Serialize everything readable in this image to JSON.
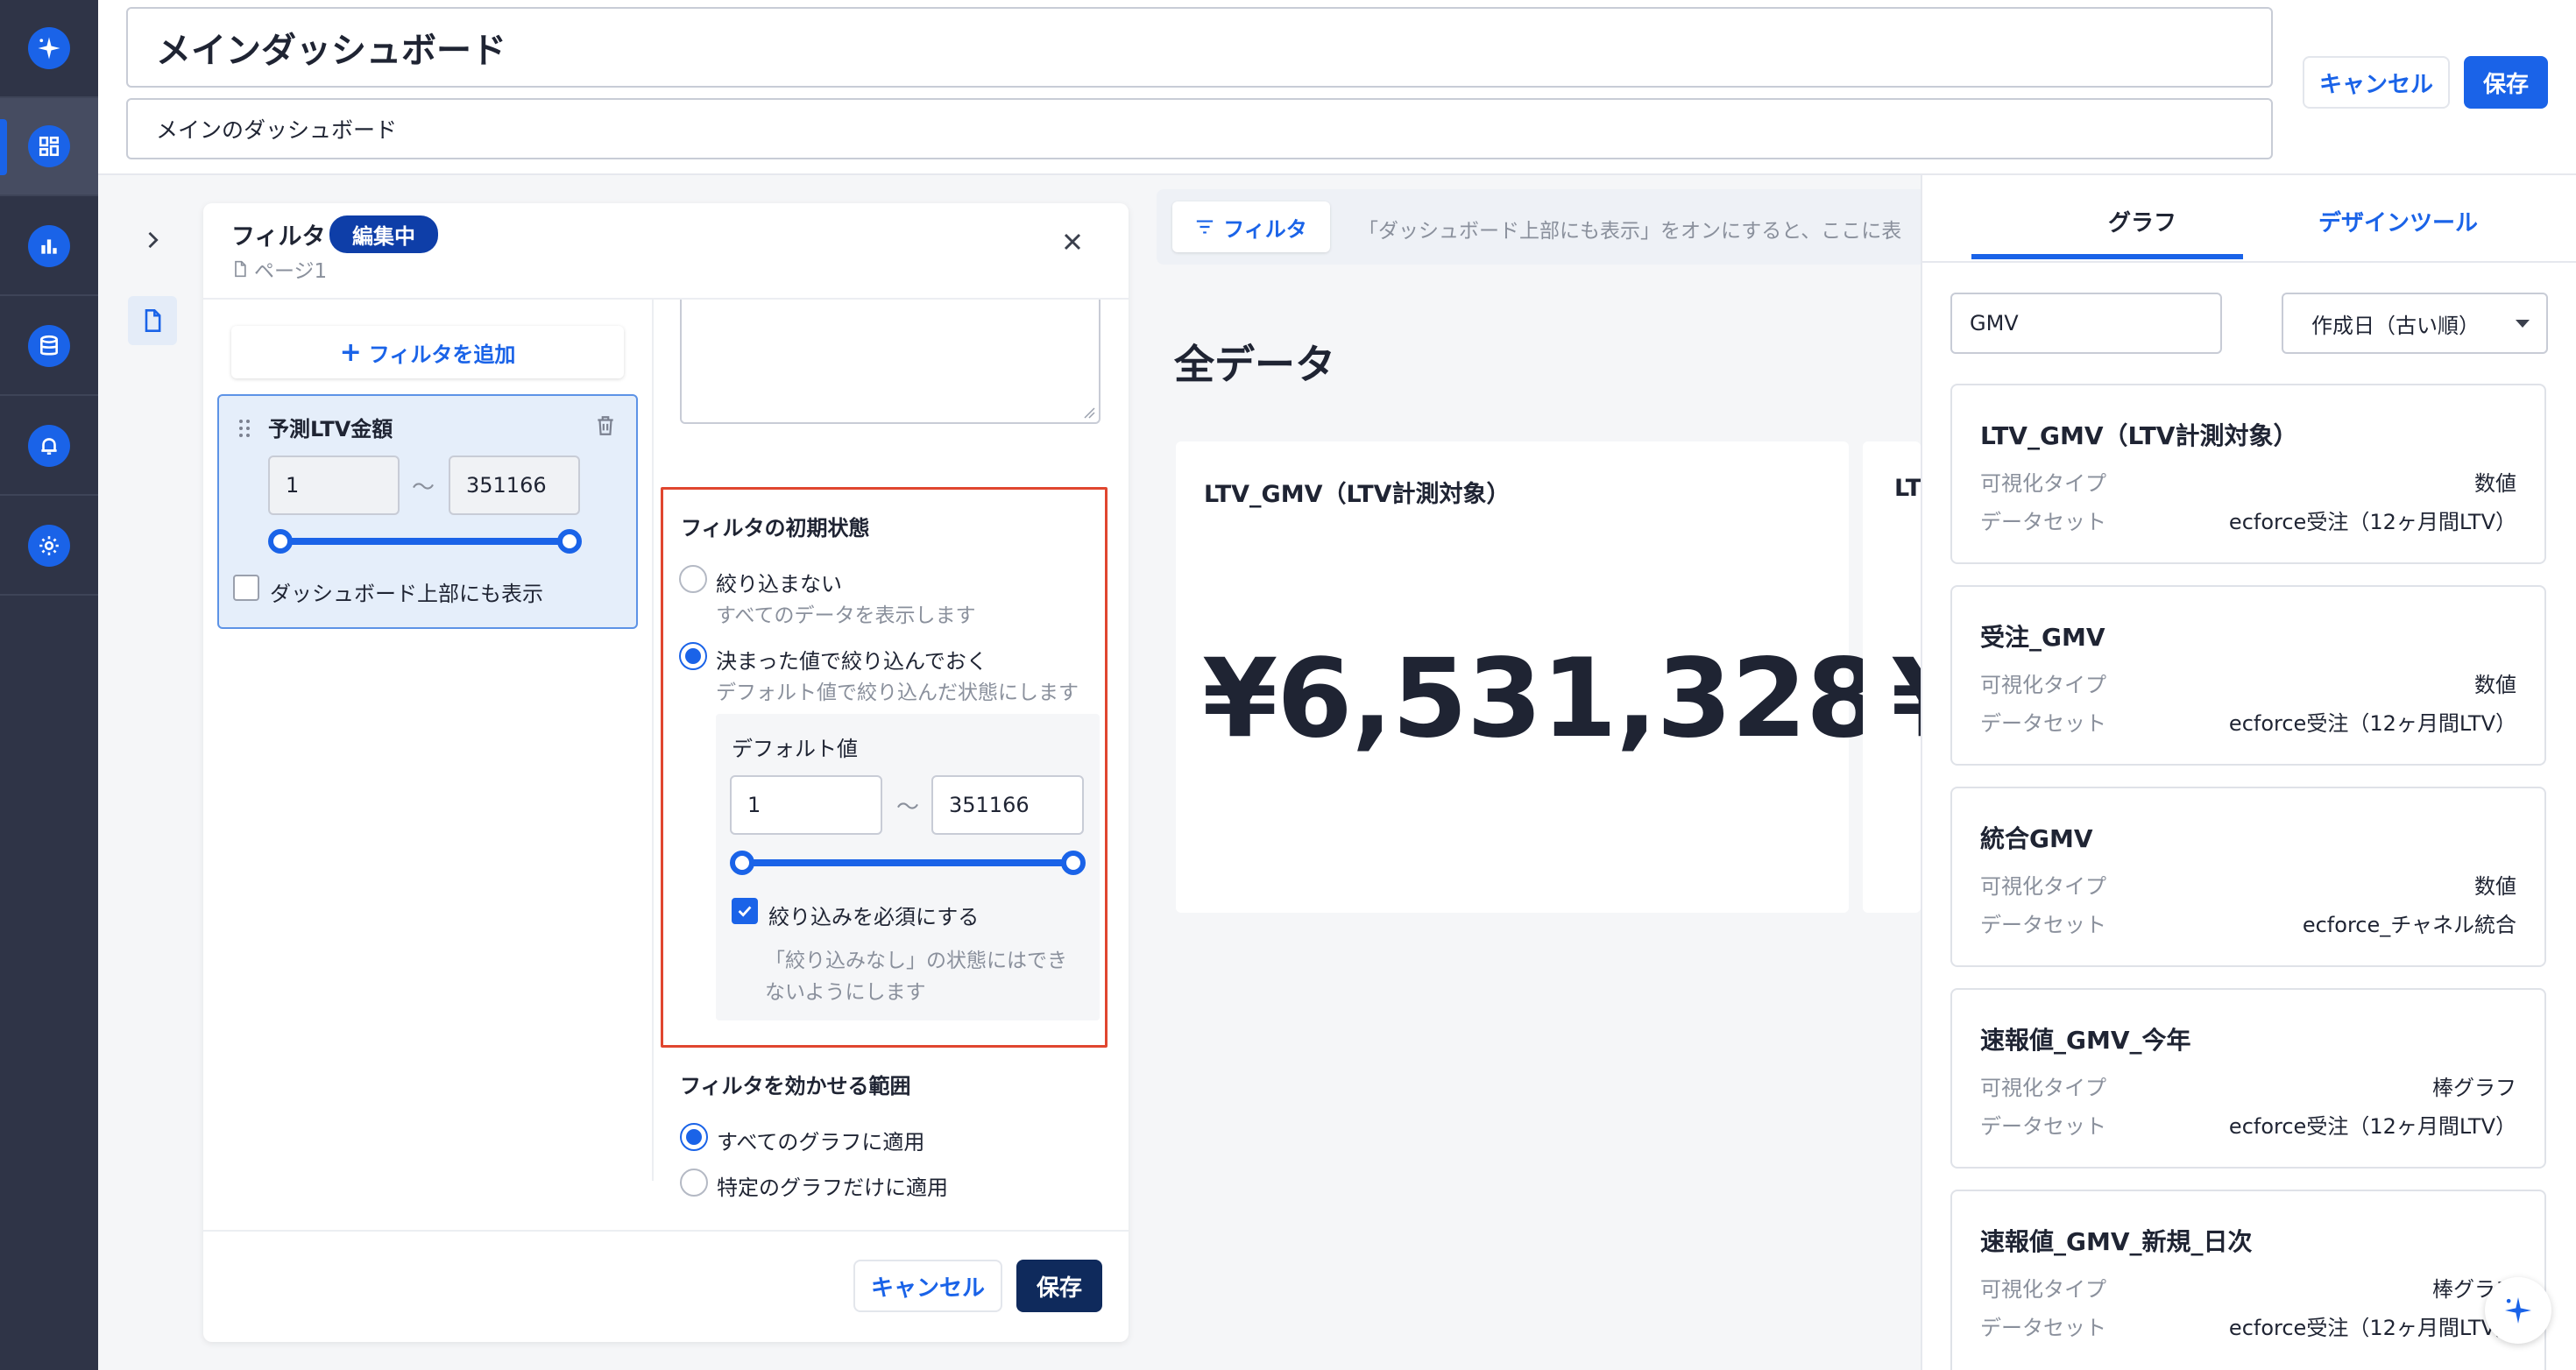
{
  "header": {
    "title": "メインダッシュボード",
    "description": "メインのダッシュボード",
    "cancel_label": "キャンセル",
    "save_label": "保存"
  },
  "sidebar": {
    "items": [
      {
        "icon": "sparkle-icon"
      },
      {
        "icon": "dashboard-icon",
        "active": true
      },
      {
        "icon": "bar-chart-icon"
      },
      {
        "icon": "database-icon"
      },
      {
        "icon": "bell-icon"
      },
      {
        "icon": "gear-icon"
      }
    ]
  },
  "filter_panel": {
    "title": "フィルタ",
    "badge": "編集中",
    "page": "ページ1",
    "add_filter_label": "フィルタを追加",
    "filter_item": {
      "name": "予測LTV金額",
      "min": "1",
      "tilde": "〜",
      "max": "351166",
      "show_on_top_label": "ダッシュボード上部にも表示",
      "show_on_top": false
    },
    "initial_state": {
      "heading": "フィルタの初期状態",
      "options": [
        {
          "label": "絞り込まない",
          "desc": "すべてのデータを表示します",
          "selected": false
        },
        {
          "label": "決まった値で絞り込んでおく",
          "desc": "デフォルト値で絞り込んだ状態にします",
          "selected": true
        }
      ],
      "default_value_label": "デフォルト値",
      "default_min": "1",
      "default_max": "351166",
      "required_label": "絞り込みを必須にする",
      "required": true,
      "required_desc_1": "「絞り込みなし」の状態にはでき",
      "required_desc_2": "ないようにします"
    },
    "scope": {
      "heading": "フィルタを効かせる範囲",
      "options": [
        {
          "label": "すべてのグラフに適用",
          "selected": true
        },
        {
          "label": "特定のグラフだけに適用",
          "selected": false
        }
      ]
    },
    "cancel_label": "キャンセル",
    "save_label": "保存"
  },
  "main": {
    "filter_button_label": "フィルタ",
    "filter_hint": "「ダッシュボード上部にも表示」をオンにすると、ここに表",
    "section_title": "全データ",
    "cards": [
      {
        "title": "LTV_GMV（LTV計測対象）",
        "value": "¥6,531,328"
      },
      {
        "title": "LT",
        "value": "¥"
      }
    ]
  },
  "right_panel": {
    "tabs": [
      {
        "label": "グラフ",
        "active": true
      },
      {
        "label": "デザインツール",
        "active": false
      }
    ],
    "search_value": "GMV",
    "sort_value": "作成日（古い順）",
    "type_key": "可視化タイプ",
    "dataset_key": "データセット",
    "graphs": [
      {
        "title": "LTV_GMV（LTV計測対象）",
        "type": "数値",
        "dataset": "ecforce受注（12ヶ月間LTV）"
      },
      {
        "title": "受注_GMV",
        "type": "数値",
        "dataset": "ecforce受注（12ヶ月間LTV）"
      },
      {
        "title": "統合GMV",
        "type": "数値",
        "dataset": "ecforce_チャネル統合"
      },
      {
        "title": "速報値_GMV_今年",
        "type": "棒グラフ",
        "dataset": "ecforce受注（12ヶ月間LTV）"
      },
      {
        "title": "速報値_GMV_新規_日次",
        "type": "棒グラフ",
        "dataset": "ecforce受注（12ヶ月間LTV）"
      }
    ]
  },
  "colors": {
    "accent": "#1a63e8",
    "navy": "#0f2a5c",
    "sidebar": "#2f3447",
    "highlight": "#e0462f"
  }
}
